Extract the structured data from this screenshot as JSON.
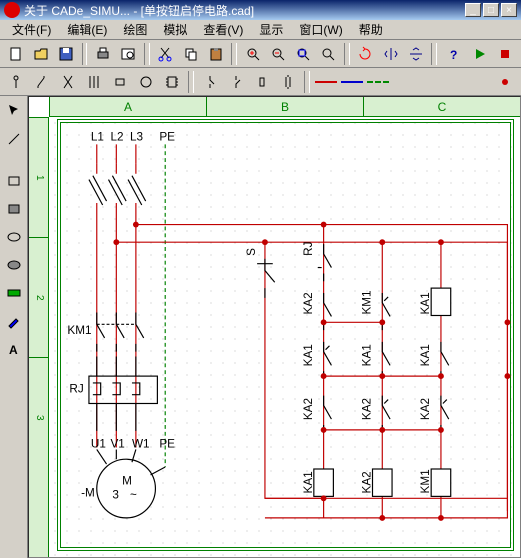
{
  "title": "关于 CADe_SIMU... - [单按钮启停电路.cad]",
  "menu": {
    "file": "文件(F)",
    "edit": "编辑(E)",
    "draw": "绘图",
    "simulate": "模拟",
    "view": "查看(V)",
    "display": "显示",
    "window": "窗口(W)",
    "help": "帮助"
  },
  "ruler_cols": [
    "A",
    "B",
    "C"
  ],
  "ruler_rows": [
    "1",
    "2",
    "3"
  ],
  "labels": {
    "l1": "L1",
    "l2": "L2",
    "l3": "L3",
    "pe": "PE",
    "km1": "KM1",
    "rj": "RJ",
    "u1": "U1",
    "v1": "V1",
    "w1": "W1",
    "pe2": "PE",
    "m": "M",
    "m3": "3",
    "mac": "~",
    "negm": "-M",
    "s": "S",
    "ka1": "KA1",
    "ka2": "KA2"
  }
}
